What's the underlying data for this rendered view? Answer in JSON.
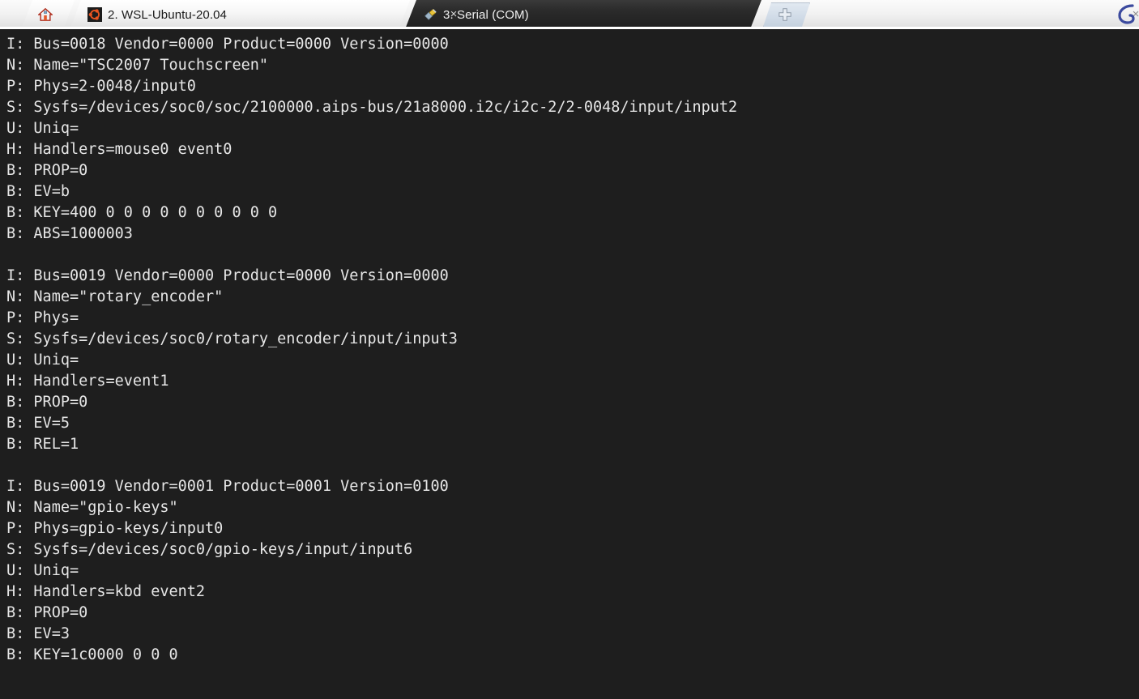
{
  "window": {
    "title": "Serial (COM)",
    "background_color": "#1e1e1e",
    "tabbar_background": "#f2f2f2"
  },
  "tabbar": {
    "home_tab": {
      "label": "",
      "icon": "home-icon",
      "active": false
    },
    "tabs": [
      {
        "label": "2. WSL-Ubuntu-20.04",
        "icon": "ubuntu-icon",
        "active": false,
        "close_label": "×"
      },
      {
        "label": "3. Serial (COM)",
        "icon": "serial-plug-icon",
        "active": true,
        "close_label": "×"
      }
    ],
    "new_tab": {
      "label": "",
      "icon": "plus-icon"
    },
    "right_icon": "app-logo-icon"
  },
  "terminal": {
    "text_color": "#e6e6e6",
    "background_color": "#1e1e1e",
    "font_size_px": 18.5,
    "line_height_px": 26,
    "lines": [
      "I: Bus=0018 Vendor=0000 Product=0000 Version=0000",
      "N: Name=\"TSC2007 Touchscreen\"",
      "P: Phys=2-0048/input0",
      "S: Sysfs=/devices/soc0/soc/2100000.aips-bus/21a8000.i2c/i2c-2/2-0048/input/input2",
      "U: Uniq=",
      "H: Handlers=mouse0 event0",
      "B: PROP=0",
      "B: EV=b",
      "B: KEY=400 0 0 0 0 0 0 0 0 0 0",
      "B: ABS=1000003",
      "",
      "I: Bus=0019 Vendor=0000 Product=0000 Version=0000",
      "N: Name=\"rotary_encoder\"",
      "P: Phys=",
      "S: Sysfs=/devices/soc0/rotary_encoder/input/input3",
      "U: Uniq=",
      "H: Handlers=event1",
      "B: PROP=0",
      "B: EV=5",
      "B: REL=1",
      "",
      "I: Bus=0019 Vendor=0001 Product=0001 Version=0100",
      "N: Name=\"gpio-keys\"",
      "P: Phys=gpio-keys/input0",
      "S: Sysfs=/devices/soc0/gpio-keys/input/input6",
      "U: Uniq=",
      "H: Handlers=kbd event2",
      "B: PROP=0",
      "B: EV=3",
      "B: KEY=1c0000 0 0 0"
    ]
  }
}
